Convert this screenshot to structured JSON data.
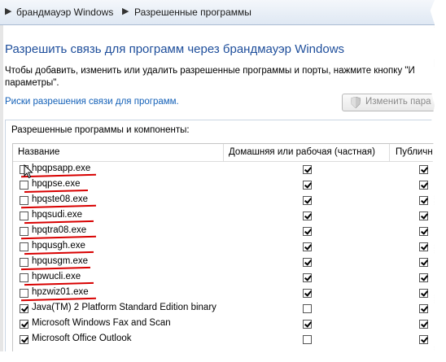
{
  "breadcrumb": {
    "first": "брандмауэр Windows",
    "second": "Разрешенные программы"
  },
  "page": {
    "title": "Разрешить связь для программ через брандмауэр Windows",
    "desc_line1": "Чтобы добавить, изменить или удалить разрешенные программы и порты, нажмите кнопку \"И",
    "desc_line2": "параметры\".",
    "risk_link": "Риски разрешения связи для программ.",
    "change_button": "Изменить пара",
    "group_label": "Разрешенные программы и компоненты:"
  },
  "table": {
    "headers": [
      "Название",
      "Домашняя или рабочая (частная)",
      "Публичн"
    ],
    "rows": [
      {
        "name": "hpqpsapp.exe",
        "enabled": false,
        "private": true,
        "public": true,
        "underlined": true
      },
      {
        "name": "hpqpse.exe",
        "enabled": false,
        "private": true,
        "public": true,
        "underlined": true
      },
      {
        "name": "hpqste08.exe",
        "enabled": false,
        "private": true,
        "public": true,
        "underlined": true
      },
      {
        "name": "hpqsudi.exe",
        "enabled": false,
        "private": true,
        "public": true,
        "underlined": true
      },
      {
        "name": "hpqtra08.exe",
        "enabled": false,
        "private": true,
        "public": true,
        "underlined": true
      },
      {
        "name": "hpqusgh.exe",
        "enabled": false,
        "private": true,
        "public": true,
        "underlined": true
      },
      {
        "name": "hpqusgm.exe",
        "enabled": false,
        "private": true,
        "public": true,
        "underlined": true
      },
      {
        "name": "hpwucli.exe",
        "enabled": false,
        "private": true,
        "public": true,
        "underlined": true
      },
      {
        "name": "hpzwiz01.exe",
        "enabled": false,
        "private": true,
        "public": true,
        "underlined": true
      },
      {
        "name": "Java(TM) 2 Platform Standard Edition binary",
        "enabled": true,
        "private": false,
        "public": true,
        "underlined": false
      },
      {
        "name": "Microsoft  Windows Fax and Scan",
        "enabled": true,
        "private": true,
        "public": true,
        "underlined": false
      },
      {
        "name": "Microsoft Office Outlook",
        "enabled": true,
        "private": false,
        "public": true,
        "underlined": false
      }
    ]
  },
  "colors": {
    "title_blue": "#1e4e9b",
    "link_blue": "#1461b8",
    "annotation_red": "#d80000"
  },
  "icons": {
    "breadcrumb_separator": "triangle-right",
    "button_icon": "uac-shield-icon",
    "cursor": "mouse-pointer-icon"
  }
}
